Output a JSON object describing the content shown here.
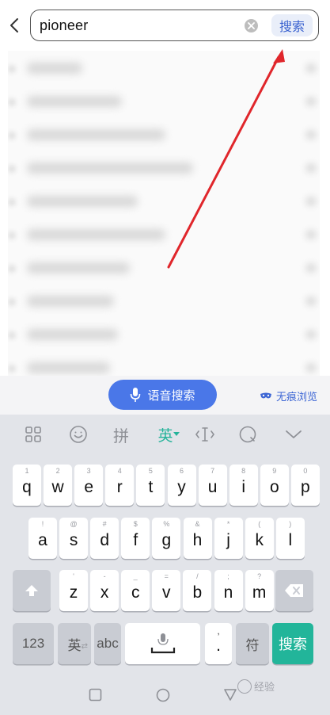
{
  "search": {
    "query": "pioneer",
    "submit_label": "搜索"
  },
  "voice": {
    "label": "语音搜索",
    "incognito_label": "无痕浏览"
  },
  "keyboard": {
    "toolbar_lang": "英",
    "toolbar_pinyin": "拼",
    "row1": [
      {
        "k": "q",
        "s": "1"
      },
      {
        "k": "w",
        "s": "2"
      },
      {
        "k": "e",
        "s": "3"
      },
      {
        "k": "r",
        "s": "4"
      },
      {
        "k": "t",
        "s": "5"
      },
      {
        "k": "y",
        "s": "6"
      },
      {
        "k": "u",
        "s": "7"
      },
      {
        "k": "i",
        "s": "8"
      },
      {
        "k": "o",
        "s": "9"
      },
      {
        "k": "p",
        "s": "0"
      }
    ],
    "row2": [
      {
        "k": "a",
        "s": "!"
      },
      {
        "k": "s",
        "s": "@"
      },
      {
        "k": "d",
        "s": "#"
      },
      {
        "k": "f",
        "s": "$"
      },
      {
        "k": "g",
        "s": "%"
      },
      {
        "k": "h",
        "s": "&"
      },
      {
        "k": "j",
        "s": "*"
      },
      {
        "k": "k",
        "s": "("
      },
      {
        "k": "l",
        "s": ")"
      }
    ],
    "row3": [
      {
        "k": "z",
        "s": "'"
      },
      {
        "k": "x",
        "s": "-"
      },
      {
        "k": "c",
        "s": "_"
      },
      {
        "k": "v",
        "s": "="
      },
      {
        "k": "b",
        "s": "/"
      },
      {
        "k": "n",
        "s": ";"
      },
      {
        "k": "m",
        "s": "?"
      }
    ],
    "num_label": "123",
    "lang_label": "英",
    "abc_label": "abc",
    "punct_main": ".",
    "punct_sub": ",",
    "symbol_label": "符",
    "enter_label": "搜索"
  },
  "watermark": "经验",
  "colors": {
    "accent_blue": "#4a77e8",
    "accent_green": "#22b59a",
    "annotation_red": "#e0262b"
  }
}
